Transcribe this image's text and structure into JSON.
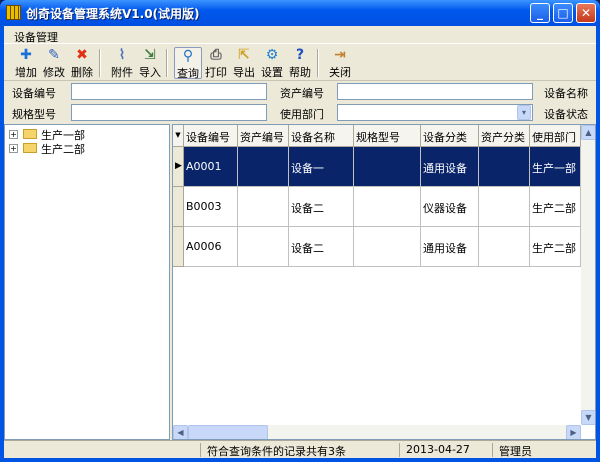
{
  "window": {
    "title": "创奇设备管理系统V1.0(试用版)",
    "min": "_",
    "max": "□",
    "close": "✕"
  },
  "menu": {
    "item": "设备管理"
  },
  "toolbar": [
    {
      "id": "add",
      "label": "增加",
      "icon": "plus-icon",
      "glyph": "✚",
      "color": "#1a6fd8"
    },
    {
      "id": "edit",
      "label": "修改",
      "icon": "pencil-icon",
      "glyph": "✎",
      "color": "#3060c0"
    },
    {
      "id": "delete",
      "label": "删除",
      "icon": "delete-x-icon",
      "glyph": "✖",
      "color": "#e03010"
    },
    {
      "id": "attach",
      "label": "附件",
      "icon": "paperclip-icon",
      "glyph": "⌇",
      "color": "#5070c0"
    },
    {
      "id": "import",
      "label": "导入",
      "icon": "import-icon",
      "glyph": "⇲",
      "color": "#3d7a40"
    },
    {
      "id": "query",
      "label": "查询",
      "icon": "magnifier-icon",
      "glyph": "⚲",
      "color": "#2070c0"
    },
    {
      "id": "print",
      "label": "打印",
      "icon": "printer-icon",
      "glyph": "⎙",
      "color": "#606060"
    },
    {
      "id": "export",
      "label": "导出",
      "icon": "export-icon",
      "glyph": "⇱",
      "color": "#d0a020"
    },
    {
      "id": "settings",
      "label": "设置",
      "icon": "gear-icon",
      "glyph": "⚙",
      "color": "#2080d0"
    },
    {
      "id": "help",
      "label": "帮助",
      "icon": "help-icon",
      "glyph": "?",
      "color": "#2050c0"
    },
    {
      "id": "close",
      "label": "关闭",
      "icon": "exit-door-icon",
      "glyph": "⇥",
      "color": "#c08030"
    }
  ],
  "filters": {
    "device_no": "设备编号",
    "asset_no": "资产编号",
    "device_name": "设备名称",
    "spec": "规格型号",
    "department": "使用部门",
    "status": "设备状态",
    "dropdown_arrow": "▾"
  },
  "tree": [
    {
      "label": "生产一部",
      "toggle": "+"
    },
    {
      "label": "生产二部",
      "toggle": "+"
    }
  ],
  "grid": {
    "columns": [
      "设备编号",
      "资产编号",
      "设备名称",
      "规格型号",
      "设备分类",
      "资产分类",
      "使用部门"
    ],
    "rows": [
      [
        "A0001",
        "",
        "设备一",
        "",
        "通用设备",
        "",
        "生产一部"
      ],
      [
        "B0003",
        "",
        "设备二",
        "",
        "仪器设备",
        "",
        "生产二部"
      ],
      [
        "A0006",
        "",
        "设备二",
        "",
        "通用设备",
        "",
        "生产二部"
      ]
    ],
    "selected_row": 0
  },
  "status": {
    "message": "符合查询条件的记录共有3条",
    "date": "2013-04-27",
    "user": "管理员"
  }
}
